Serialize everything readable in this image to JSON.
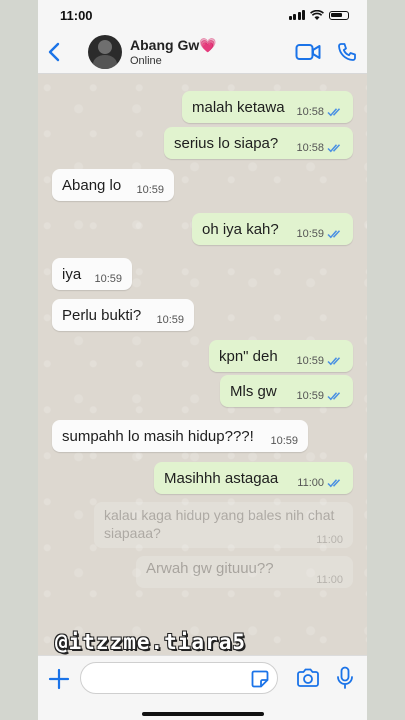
{
  "status_bar": {
    "time": "11:00"
  },
  "header": {
    "contact_name": "Abang Gw💗",
    "contact_status": "Online"
  },
  "messages": [
    {
      "text": "malah ketawa",
      "time": "10:58",
      "direction": "out",
      "read": true
    },
    {
      "text": "serius lo siapa?",
      "time": "10:58",
      "direction": "out",
      "read": true
    },
    {
      "text": "Abang lo",
      "time": "10:59",
      "direction": "in"
    },
    {
      "text": "oh iya kah?",
      "time": "10:59",
      "direction": "out",
      "read": true
    },
    {
      "text": "iya",
      "time": "10:59",
      "direction": "in"
    },
    {
      "text": "Perlu bukti?",
      "time": "10:59",
      "direction": "in"
    },
    {
      "text": "kpn\" deh",
      "time": "10:59",
      "direction": "out",
      "read": true
    },
    {
      "text": "Mls gw",
      "time": "10:59",
      "direction": "out",
      "read": true
    },
    {
      "text": "sumpahh lo masih hidup???!",
      "time": "10:59",
      "direction": "in"
    },
    {
      "text": "Masihhh astagaa",
      "time": "11:00",
      "direction": "out",
      "read": true
    },
    {
      "text": "kalau kaga hidup yang bales nih chat siapaaa?",
      "time": "11:00",
      "direction": "out",
      "faded": true
    },
    {
      "text": "Arwah gw gituuu??",
      "time": "11:00",
      "direction": "out",
      "faded": true
    }
  ],
  "watermark": "@itzzme.tiara5",
  "colors": {
    "accent": "#1a73e8",
    "read_tick": "#4a90e2",
    "outgoing_bubble": "#e1f3cf"
  }
}
